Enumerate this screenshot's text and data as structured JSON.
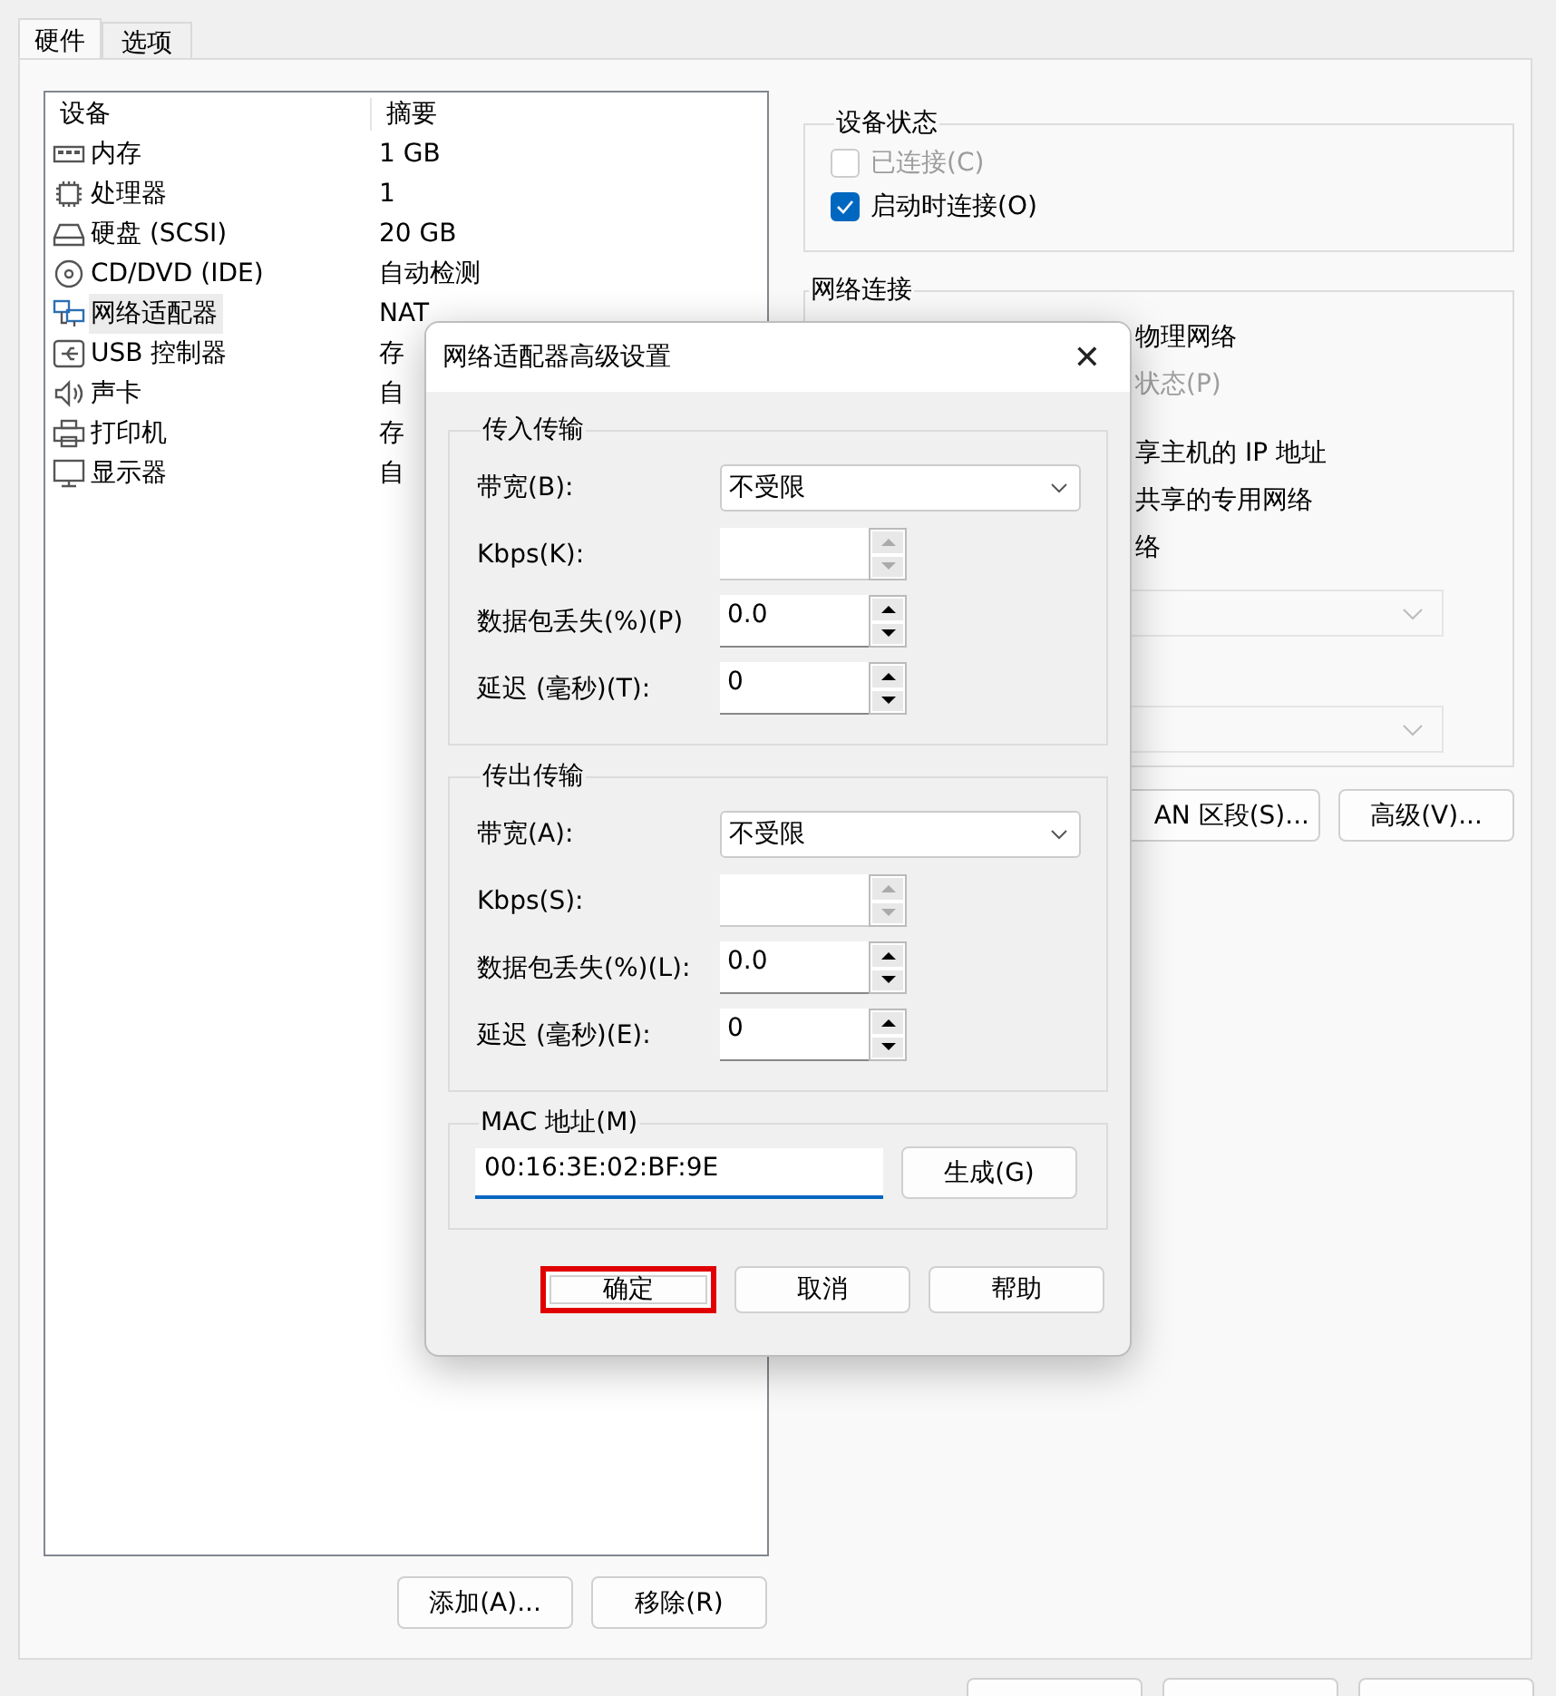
{
  "tabs": [
    {
      "label": "硬件",
      "selected": true
    },
    {
      "label": "选项",
      "selected": false
    }
  ],
  "device_table": {
    "columns": [
      "设备",
      "摘要"
    ],
    "rows": [
      {
        "kind": "memory",
        "device": "内存",
        "summary": "1 GB",
        "selected": false
      },
      {
        "kind": "cpu",
        "device": "处理器",
        "summary": "1",
        "selected": false
      },
      {
        "kind": "disk",
        "device": "硬盘 (SCSI)",
        "summary": "20 GB",
        "selected": false
      },
      {
        "kind": "disc",
        "device": "CD/DVD (IDE)",
        "summary": "自动检测",
        "selected": false
      },
      {
        "kind": "network",
        "device": "网络适配器",
        "summary": "NAT",
        "selected": true
      },
      {
        "kind": "usb",
        "device": "USB 控制器",
        "summary": "存",
        "selected": false
      },
      {
        "kind": "sound",
        "device": "声卡",
        "summary": "自",
        "selected": false
      },
      {
        "kind": "printer",
        "device": "打印机",
        "summary": "存",
        "selected": false
      },
      {
        "kind": "display",
        "device": "显示器",
        "summary": "自",
        "selected": false
      }
    ]
  },
  "device_buttons": [
    "添加(A)...",
    "移除(R)"
  ],
  "device_status": {
    "title": "设备状态",
    "options": [
      {
        "label": "已连接(C)",
        "checked": false,
        "disabled": true
      },
      {
        "label": "启动时连接(O)",
        "checked": true,
        "disabled": false
      }
    ]
  },
  "network_connection": {
    "title": "网络连接",
    "lines": [
      {
        "text": "物理网络",
        "disabled": false
      },
      {
        "text": "状态(P)",
        "disabled": true
      },
      {
        "text": "享主机的 IP 地址",
        "disabled": false
      },
      {
        "text": "共享的专用网络",
        "disabled": false
      },
      {
        "text": "络",
        "disabled": false
      }
    ]
  },
  "network_buttons": [
    "AN 区段(S)...",
    "高级(V)..."
  ],
  "dialog": {
    "title": "网络适配器高级设置",
    "close": "✕",
    "groups": [
      {
        "title": "传入传输",
        "rows": [
          {
            "kind": "dropdown",
            "label": "带宽(B):",
            "value": "不受限"
          },
          {
            "kind": "spinner",
            "label": "Kbps(K):",
            "disabled": true
          },
          {
            "kind": "spinner",
            "label": "数据包丢失(%)(P)",
            "value": "0.0",
            "disabled": false
          },
          {
            "kind": "spinner",
            "label": "延迟 (毫秒)(T):",
            "value": "0",
            "disabled": false
          }
        ]
      },
      {
        "title": "传出传输",
        "rows": [
          {
            "kind": "dropdown",
            "label": "带宽(A):",
            "value": "不受限"
          },
          {
            "kind": "spinner",
            "label": "Kbps(S):",
            "disabled": true
          },
          {
            "kind": "spinner",
            "label": "数据包丢失(%)(L):",
            "value": "0.0",
            "disabled": false
          },
          {
            "kind": "spinner",
            "label": "延迟 (毫秒)(E):",
            "value": "0",
            "disabled": false
          }
        ]
      }
    ],
    "mac": {
      "title": "MAC 地址(M)",
      "value": "00:16:3E:02:BF:9E",
      "button": "生成(G)"
    },
    "buttons": [
      {
        "label": "确定",
        "highlighted": true
      },
      {
        "label": "取消",
        "highlighted": false
      },
      {
        "label": "帮助",
        "highlighted": false
      }
    ]
  }
}
